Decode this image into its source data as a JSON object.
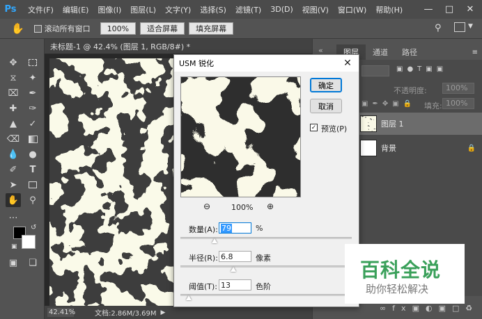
{
  "app": {
    "logo": "Ps"
  },
  "menu": [
    "文件(F)",
    "编辑(E)",
    "图像(I)",
    "图层(L)",
    "文字(Y)",
    "选择(S)",
    "滤镜(T)",
    "3D(D)",
    "视图(V)",
    "窗口(W)",
    "帮助(H)"
  ],
  "options": {
    "scroll_all_label": "滚动所有窗口",
    "zoom_100": "100%",
    "fit_screen": "适合屏幕",
    "fill_screen": "填充屏幕"
  },
  "document": {
    "tab_title": "未标题-1 @ 42.4% (图层 1, RGB/8#) *",
    "zoom_status": "42.41%",
    "doc_size": "文档:2.86M/3.69M"
  },
  "panels": {
    "tabs": [
      "图层",
      "通道",
      "路径"
    ],
    "opacity_label": "不透明度:",
    "opacity_value": "100%",
    "fill_label": "填充:",
    "fill_value": "100%",
    "layers": [
      {
        "name": "图层 1"
      },
      {
        "name": "背景"
      }
    ]
  },
  "dialog": {
    "title": "USM 锐化",
    "ok": "确定",
    "cancel": "取消",
    "preview_label": "预览(P)",
    "preview_checked": true,
    "preview_zoom": "100%",
    "amount_label": "数量(A):",
    "amount_value": "79",
    "amount_unit": "%",
    "amount_slider": 0.2,
    "radius_label": "半径(R):",
    "radius_value": "6.8",
    "radius_unit": "像素",
    "radius_slider": 0.31,
    "threshold_label": "阈值(T):",
    "threshold_value": "13",
    "threshold_unit": "色阶",
    "threshold_slider": 0.05
  },
  "watermark": {
    "title": "百科全说",
    "subtitle": "助你轻松解决"
  },
  "colors": {
    "accent": "#31a8ff",
    "pattern_light": "#f4f3cf",
    "pattern_dark": "#0d0d0d",
    "watermark_green": "#3aa05a"
  }
}
